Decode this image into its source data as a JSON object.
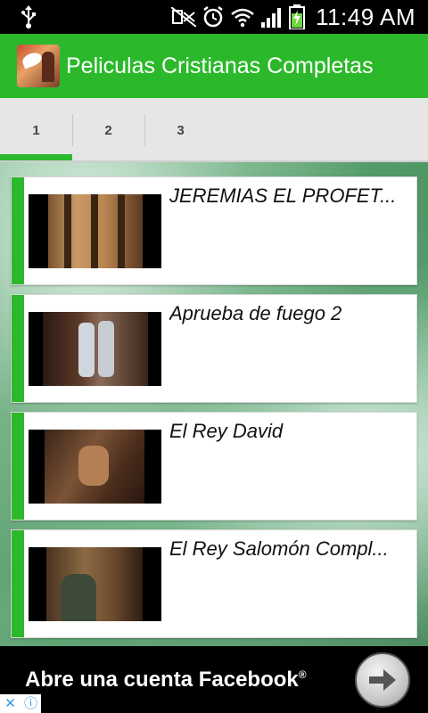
{
  "status_bar": {
    "time": "11:49 AM",
    "icons": [
      "usb-icon",
      "mute-icon",
      "alarm-icon",
      "wifi-icon",
      "signal-icon",
      "battery-charging-icon"
    ]
  },
  "app": {
    "title": "Peliculas Cristianas Completas",
    "icon": "app-logo-icon"
  },
  "tabs": [
    {
      "label": "1",
      "active": true
    },
    {
      "label": "2",
      "active": false
    },
    {
      "label": "3",
      "active": false
    }
  ],
  "movies": [
    {
      "title": "JEREMIAS EL PROFET..."
    },
    {
      "title": "Aprueba de fuego 2"
    },
    {
      "title": "El Rey David"
    },
    {
      "title": "El Rey Salomón Compl..."
    }
  ],
  "ad": {
    "text": "Abre una cuenta Facebook",
    "trademark": "®",
    "close_glyph": "✕",
    "info_glyph": "ⓘ"
  },
  "colors": {
    "accent": "#2bb92b",
    "tab_bar": "#e6e6e6",
    "status_bar": "#000000"
  }
}
